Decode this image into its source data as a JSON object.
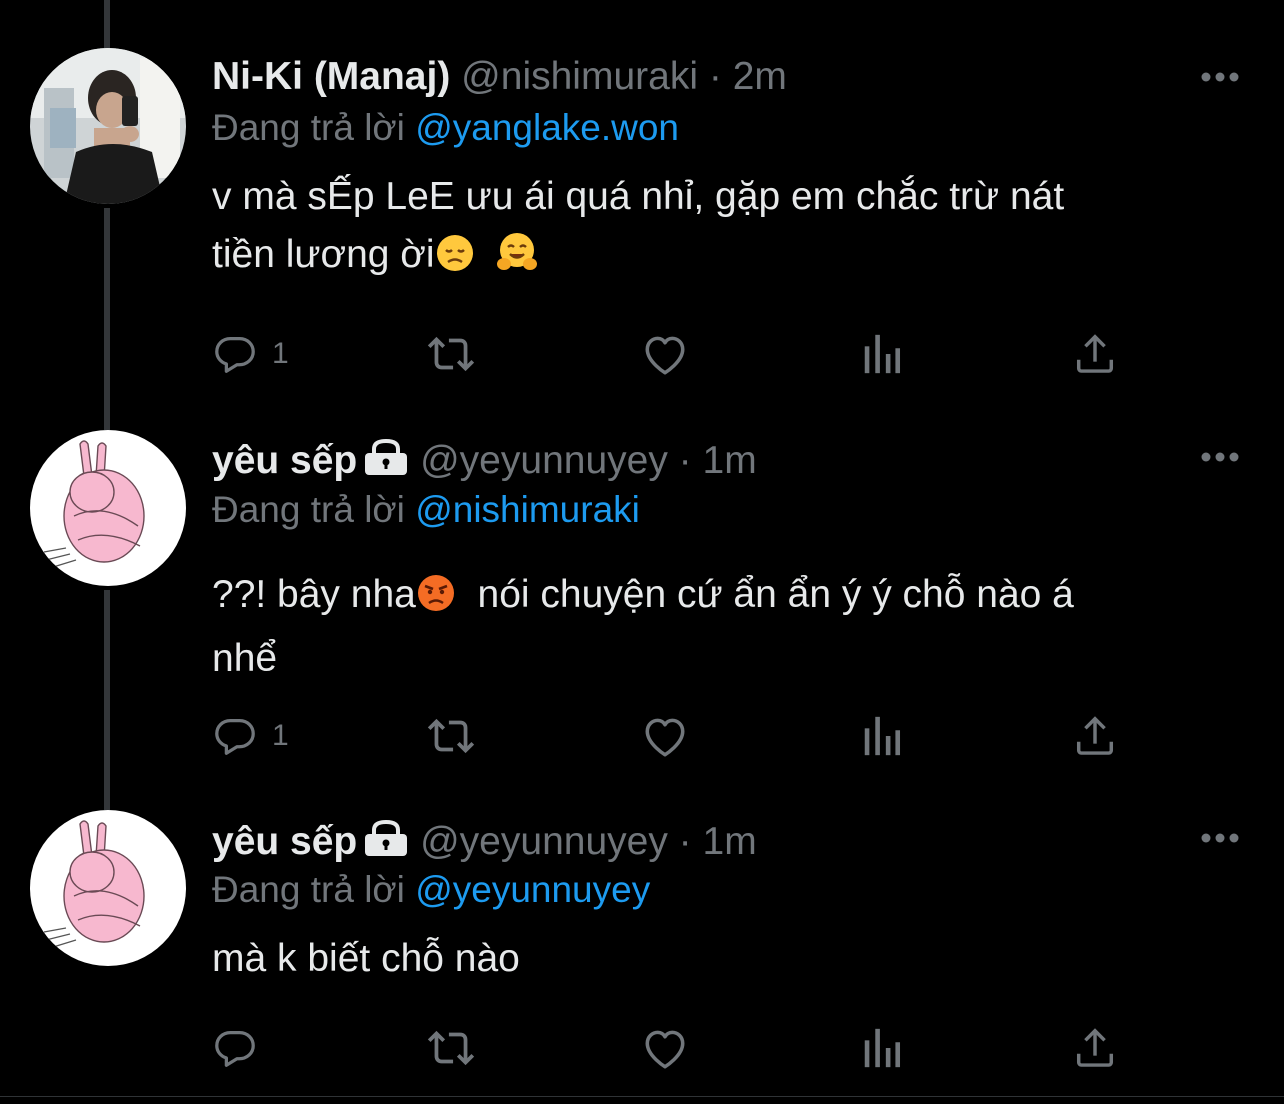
{
  "tweets": [
    {
      "display_name": "Ni-Ki (Manaj)",
      "locked": false,
      "handle": "@nishimuraki",
      "dot": "·",
      "time": "2m",
      "reply_prefix": "Đang trả lời",
      "reply_to": "@yanglake.won",
      "body_line1": "v mà sẾp LeE ưu ái quá nhỉ, gặp em chắc trừ nát",
      "body_line2": "tiền lương ời",
      "emojis": [
        "disappointed-face",
        "hugging-face"
      ],
      "reply_count": "1",
      "avatar": "photo-avatar"
    },
    {
      "display_name": "yêu sếp",
      "locked": true,
      "handle": "@yeyunnuyey",
      "dot": "·",
      "time": "1m",
      "reply_prefix": "Đang trả lời",
      "reply_to": "@nishimuraki",
      "body_line1_a": "??! bây nha",
      "body_line1_b": "nói chuyện cứ ẩn ẩn ý ý chỗ nào á",
      "body_line2": "nhể",
      "emojis": [
        "angry-face"
      ],
      "reply_count": "1",
      "avatar": "pink-bunny-avatar"
    },
    {
      "display_name": "yêu sếp",
      "locked": true,
      "handle": "@yeyunnuyey",
      "dot": "·",
      "time": "1m",
      "reply_prefix": "Đang trả lời",
      "reply_to": "@yeyunnuyey",
      "body_line1": "mà k biết chỗ nào",
      "reply_count": "",
      "avatar": "pink-bunny-avatar"
    }
  ],
  "icons": {
    "reply": "speech-bubble-icon",
    "retweet": "retweet-icon",
    "like": "heart-icon",
    "views": "bar-chart-icon",
    "share": "share-icon",
    "more": "ellipsis-icon",
    "lock": "lock-icon"
  },
  "colors": {
    "background": "#000000",
    "text": "#e7e9ea",
    "muted": "#71767b",
    "link": "#1d9bf0",
    "thread_line": "#333639"
  }
}
